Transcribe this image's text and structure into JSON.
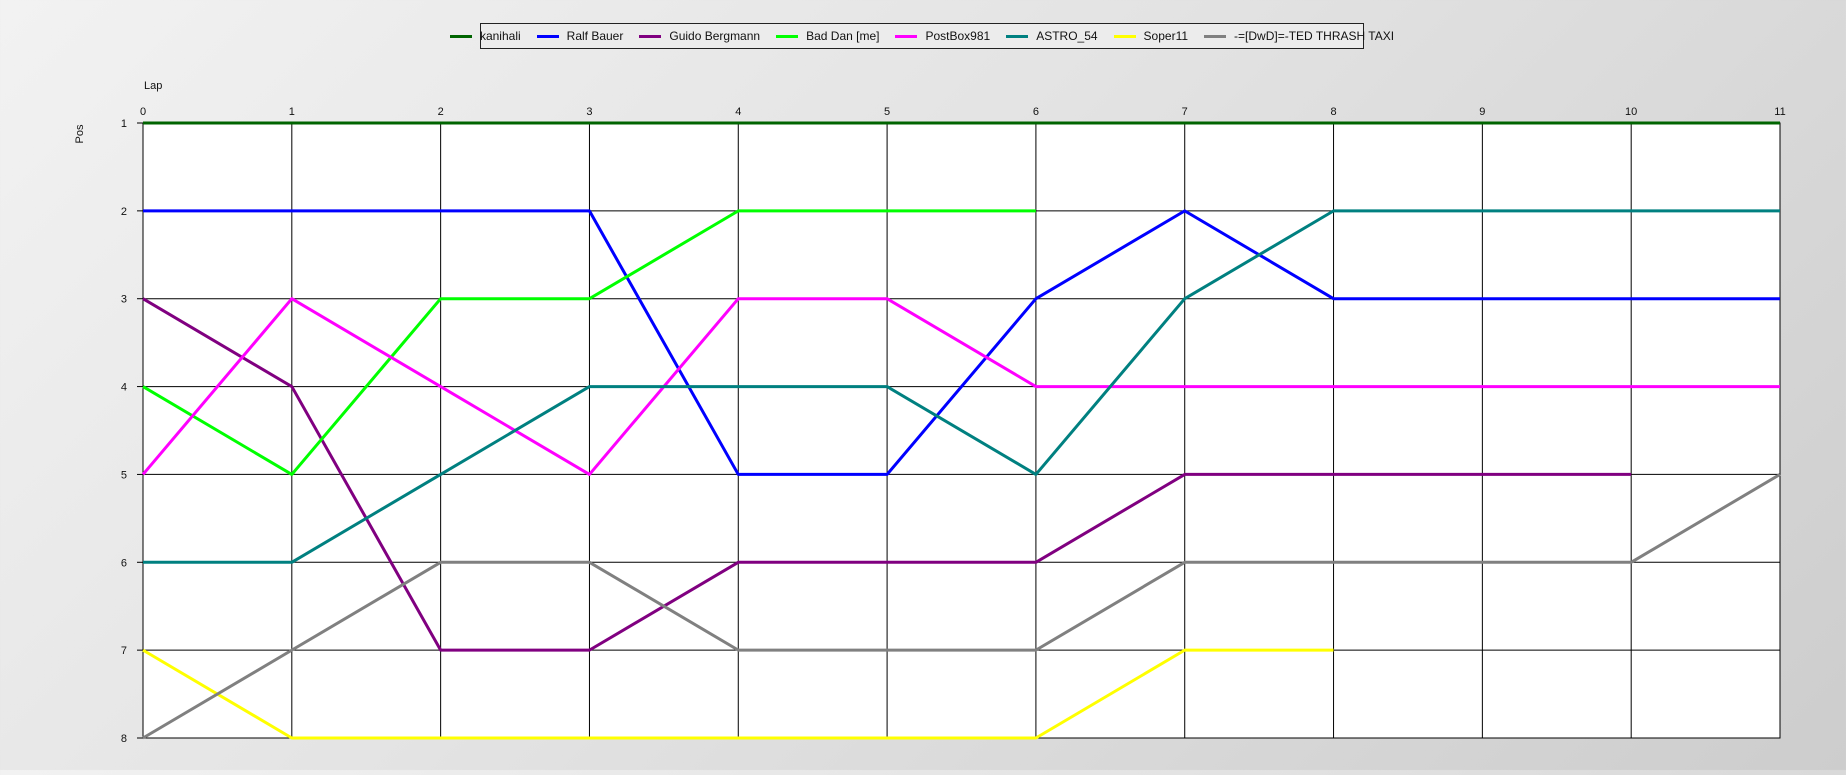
{
  "chart_data": {
    "type": "line",
    "xlabel": "Lap",
    "ylabel": "Pos",
    "x": [
      0,
      1,
      2,
      3,
      4,
      5,
      6,
      7,
      8,
      9,
      10,
      11
    ],
    "xlim": [
      0,
      11
    ],
    "ylim": [
      1,
      8
    ],
    "y_inverted": true,
    "grid": true,
    "legend_position": "top-center",
    "series": [
      {
        "name": "kanihali",
        "color": "#006400",
        "values": [
          1,
          1,
          1,
          1,
          1,
          1,
          1,
          1,
          1,
          1,
          1,
          1
        ]
      },
      {
        "name": "Ralf Bauer",
        "color": "#0000FF",
        "values": [
          2,
          2,
          2,
          2,
          5,
          5,
          3,
          2,
          3,
          3,
          3,
          3
        ]
      },
      {
        "name": "Guido Bergmann",
        "color": "#800080",
        "values": [
          3,
          4,
          7,
          7,
          6,
          6,
          6,
          5,
          5,
          5,
          5,
          null
        ]
      },
      {
        "name": "Bad Dan [me]",
        "color": "#00FF00",
        "values": [
          4,
          5,
          3,
          3,
          2,
          2,
          2,
          null,
          null,
          null,
          null,
          null
        ]
      },
      {
        "name": "PostBox981",
        "color": "#FF00FF",
        "values": [
          5,
          3,
          4,
          5,
          3,
          3,
          4,
          4,
          4,
          4,
          4,
          4
        ]
      },
      {
        "name": "ASTRO_54",
        "color": "#008080",
        "values": [
          6,
          6,
          5,
          4,
          4,
          4,
          5,
          3,
          2,
          2,
          2,
          2
        ]
      },
      {
        "name": "Soper11",
        "color": "#FFFF00",
        "values": [
          7,
          8,
          8,
          8,
          8,
          8,
          8,
          7,
          7,
          null,
          null,
          null
        ]
      },
      {
        "name": "-=[DwD]=-TED THRASH TAXI",
        "color": "#808080",
        "values": [
          8,
          7,
          6,
          6,
          7,
          7,
          7,
          6,
          6,
          6,
          6,
          5
        ]
      }
    ]
  }
}
